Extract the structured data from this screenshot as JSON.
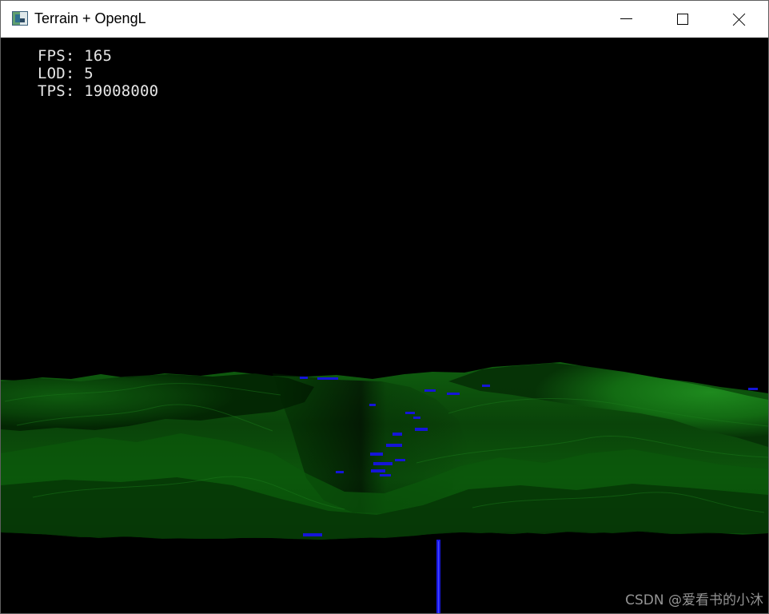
{
  "window": {
    "title": "Terrain + OpengL",
    "icon": "app-window-icon",
    "controls": {
      "minimize_icon": "minimize-icon",
      "maximize_icon": "maximize-icon",
      "close_icon": "close-icon"
    }
  },
  "hud": {
    "fps_label": "FPS:",
    "fps_value": "165",
    "lod_label": "LOD:",
    "lod_value": "5",
    "tps_label": "TPS:",
    "tps_value": "19008000",
    "text_color": "#e6e6e6"
  },
  "scene": {
    "background_color": "#000000",
    "terrain_colors": [
      "#002500",
      "#0a4b0a",
      "#137313",
      "#209220"
    ],
    "water_color": "#1111d6"
  },
  "watermark": {
    "text": "CSDN @爱看书的小沐"
  }
}
